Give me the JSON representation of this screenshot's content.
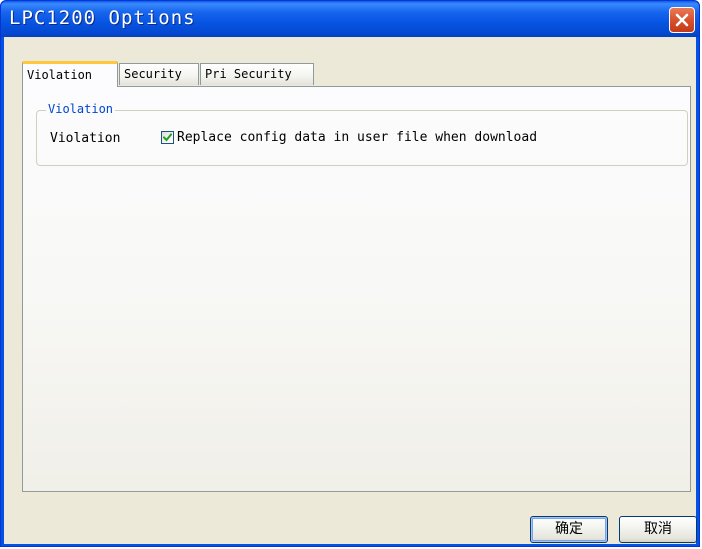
{
  "window": {
    "title": "LPC1200 Options"
  },
  "tabs": [
    {
      "label": "Violation",
      "active": true
    },
    {
      "label": "Security",
      "active": false
    },
    {
      "label": "Pri Security",
      "active": false
    }
  ],
  "violation_group": {
    "legend": "Violation",
    "field_label": "Violation",
    "checkbox": {
      "label": "Replace config data in user file when download",
      "checked": true
    }
  },
  "buttons": {
    "ok_label": "确定",
    "cancel_label": "取消"
  },
  "colors": {
    "titlebar": "#0054e3",
    "close_button": "#d8512e",
    "active_tab_highlight": "#ffc83c",
    "group_legend_text": "#0046d5",
    "checkmark": "#21a121",
    "dialog_face": "#ece9d8"
  },
  "icons": {
    "close": "close-icon",
    "check": "checkmark-icon"
  }
}
